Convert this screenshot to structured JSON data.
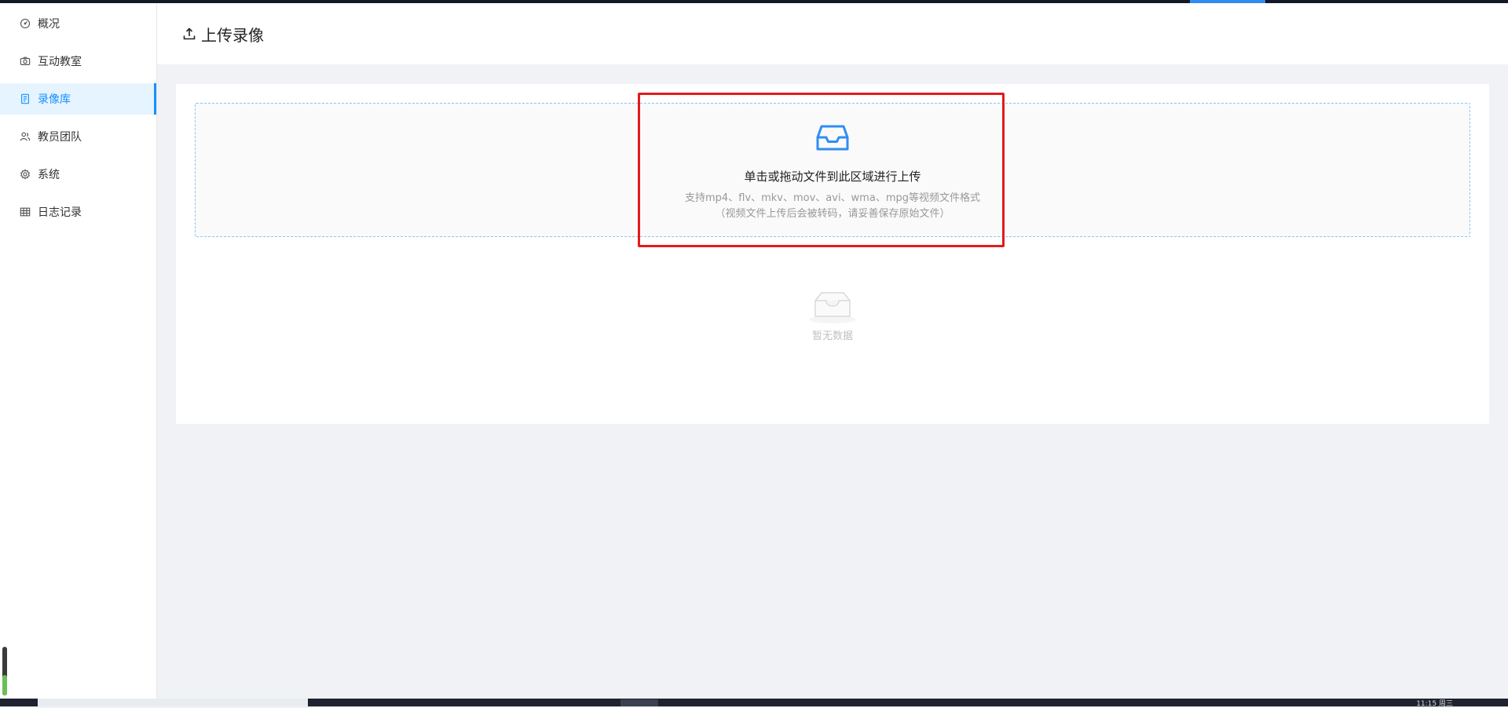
{
  "sidebar": {
    "items": [
      {
        "label": "概况",
        "icon": "dashboard-icon"
      },
      {
        "label": "互动教室",
        "icon": "camera-icon"
      },
      {
        "label": "录像库",
        "icon": "book-icon",
        "active": true
      },
      {
        "label": "教员团队",
        "icon": "team-icon"
      },
      {
        "label": "系统",
        "icon": "gear-icon"
      },
      {
        "label": "日志记录",
        "icon": "table-icon"
      }
    ]
  },
  "header": {
    "title": "上传录像",
    "icon": "upload-icon"
  },
  "upload": {
    "main_text": "单击或拖动文件到此区域进行上传",
    "hint_line1": "支持mp4、flv、mkv、mov、avi、wma、mpg等视频文件格式",
    "hint_line2": "（视频文件上传后会被转码，请妥善保存原始文件）",
    "icon": "inbox-icon"
  },
  "empty": {
    "text": "暂无数据",
    "icon": "empty-inbox-icon"
  },
  "taskbar": {
    "clock": "11:15 周三"
  },
  "colors": {
    "accent": "#1890ff",
    "annotation": "#e11b1b",
    "background": "#f0f2f5"
  }
}
